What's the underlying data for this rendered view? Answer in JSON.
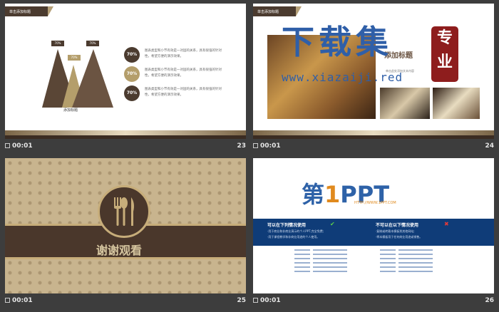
{
  "slides": [
    {
      "number": "23",
      "time": "00:01",
      "header": "单击添加标题",
      "peak_labels": [
        "70%",
        "70%",
        "70%"
      ],
      "chart_caption": "添加标题",
      "items": [
        {
          "pct": "70%",
          "text": "图表类型和小节有效是一对固的关系，具有很强的针对性，希望方便的演示效果。"
        },
        {
          "pct": "70%",
          "text": "图表类型和小节有效是一对固的关系，具有很强的针对性，希望方便的演示效果。"
        },
        {
          "pct": "70%",
          "text": "图表类型和小节有效是一对固的关系，具有很强的针对性，希望方便的演示效果。"
        }
      ],
      "colors": {
        "dark": "#4b3b2f",
        "gold": "#b49e6b"
      }
    },
    {
      "number": "24",
      "time": "00:01",
      "header": "单击添加标题",
      "watermark": "下载集",
      "watermark_url": "www.xiazaiji.red",
      "seal_text": "专业",
      "title_fragment": "添加标题",
      "side_text": "单击此处添加文本内容"
    },
    {
      "number": "25",
      "time": "00:01",
      "title": "谢谢观看",
      "emblem_icon": "fork-spoon-knife-icon"
    },
    {
      "number": "26",
      "time": "00:01",
      "logo_prefix": "第",
      "logo_one": "1",
      "logo_suffix": "PPT",
      "logo_url": "HTTP://WWW.1PPT.COM",
      "left_title": "可以在下列情况使用",
      "left_lines": [
        "·用于商业和非商业演示的个人PPT,完全免费;",
        "·用于课程教学和非商业用途的个人使用。"
      ],
      "right_title": "不可以在以下情况使用",
      "right_lines": [
        "·复制或转载本模板到其他网站;",
        "·将本模板用于任何商业用途或销售。"
      ]
    }
  ]
}
